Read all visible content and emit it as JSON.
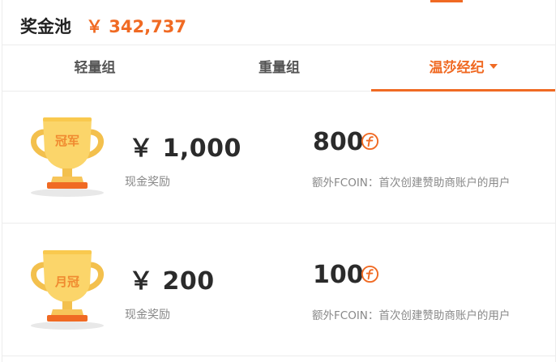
{
  "header": {
    "title": "奖金池",
    "amount": "￥ 342,737"
  },
  "tabs": [
    {
      "label": "轻量组"
    },
    {
      "label": "重量组"
    },
    {
      "label": "温莎经纪"
    }
  ],
  "prizes": [
    {
      "trophy_text": "冠军",
      "cash": "￥ 1,000",
      "cash_label": "现金奖励",
      "coin": "800",
      "coin_label": "额外FCOIN：首次创建赞助商账户的用户"
    },
    {
      "trophy_text": "月冠",
      "cash": "￥ 200",
      "cash_label": "现金奖励",
      "coin": "100",
      "coin_label": "额外FCOIN：首次创建赞助商账户的用户"
    }
  ],
  "colors": {
    "accent": "#f06a23",
    "trophy": "#fbd56a",
    "trophy_base": "#f06a23"
  },
  "icons": {
    "coin": "fcoin-icon",
    "dropdown": "caret-down-icon"
  }
}
